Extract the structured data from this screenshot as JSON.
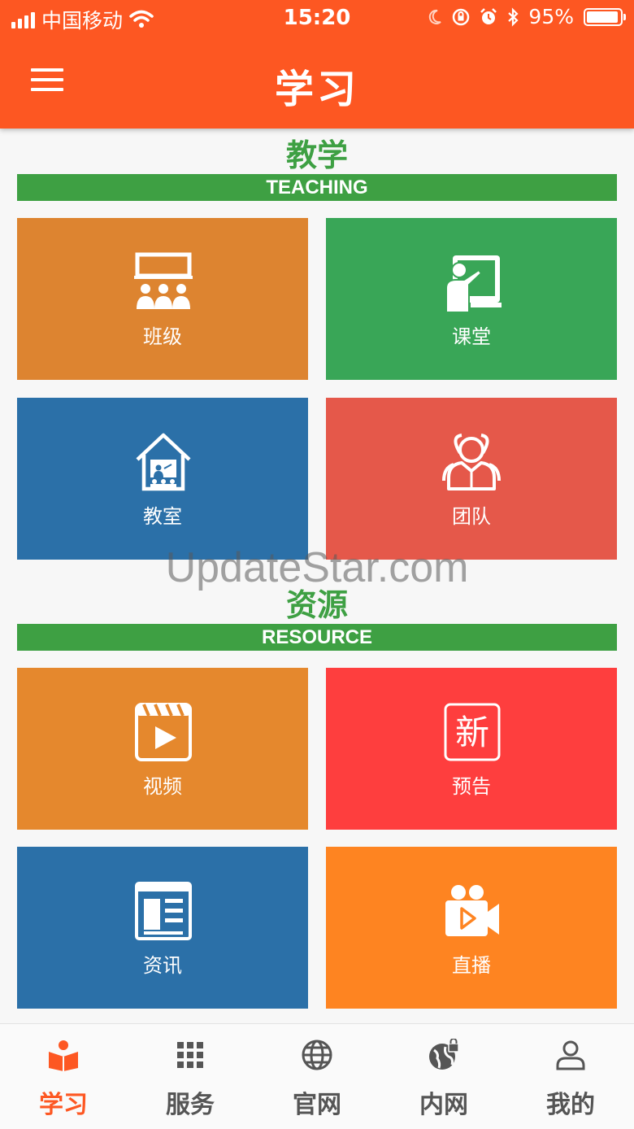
{
  "status_bar": {
    "carrier": "中国移动",
    "time": "15:20",
    "battery_text": "95%",
    "battery_level": 0.95
  },
  "header": {
    "title": "学习",
    "menu_icon": "hamburger-menu-icon"
  },
  "sections": [
    {
      "title": "教学",
      "subtitle": "TEACHING",
      "tiles": [
        {
          "label": "班级",
          "icon": "class-icon",
          "color": "#dd8430"
        },
        {
          "label": "课堂",
          "icon": "lecture-icon",
          "color": "#39a657"
        },
        {
          "label": "教室",
          "icon": "classroom-house-icon",
          "color": "#2b70a8"
        },
        {
          "label": "团队",
          "icon": "team-icon",
          "color": "#e5584a"
        }
      ]
    },
    {
      "title": "资源",
      "subtitle": "RESOURCE",
      "tiles": [
        {
          "label": "视频",
          "icon": "video-clapper-icon",
          "color": "#e5882d"
        },
        {
          "label": "预告",
          "icon": "new-badge-icon",
          "color": "#fe3e3e",
          "badge_text": "新"
        },
        {
          "label": "资讯",
          "icon": "news-icon",
          "color": "#2b70a8"
        },
        {
          "label": "直播",
          "icon": "live-camera-icon",
          "color": "#fe8421"
        }
      ]
    }
  ],
  "watermark": "UpdateStar.com",
  "tabbar": [
    {
      "label": "学习",
      "icon": "book-icon",
      "active": true
    },
    {
      "label": "服务",
      "icon": "grid-icon",
      "active": false
    },
    {
      "label": "官网",
      "icon": "globe-icon",
      "active": false
    },
    {
      "label": "内网",
      "icon": "globe-lock-icon",
      "active": false
    },
    {
      "label": "我的",
      "icon": "user-icon",
      "active": false
    }
  ],
  "colors": {
    "primary": "#fd5722",
    "section_green": "#3ea043",
    "tab_inactive": "#555555"
  }
}
